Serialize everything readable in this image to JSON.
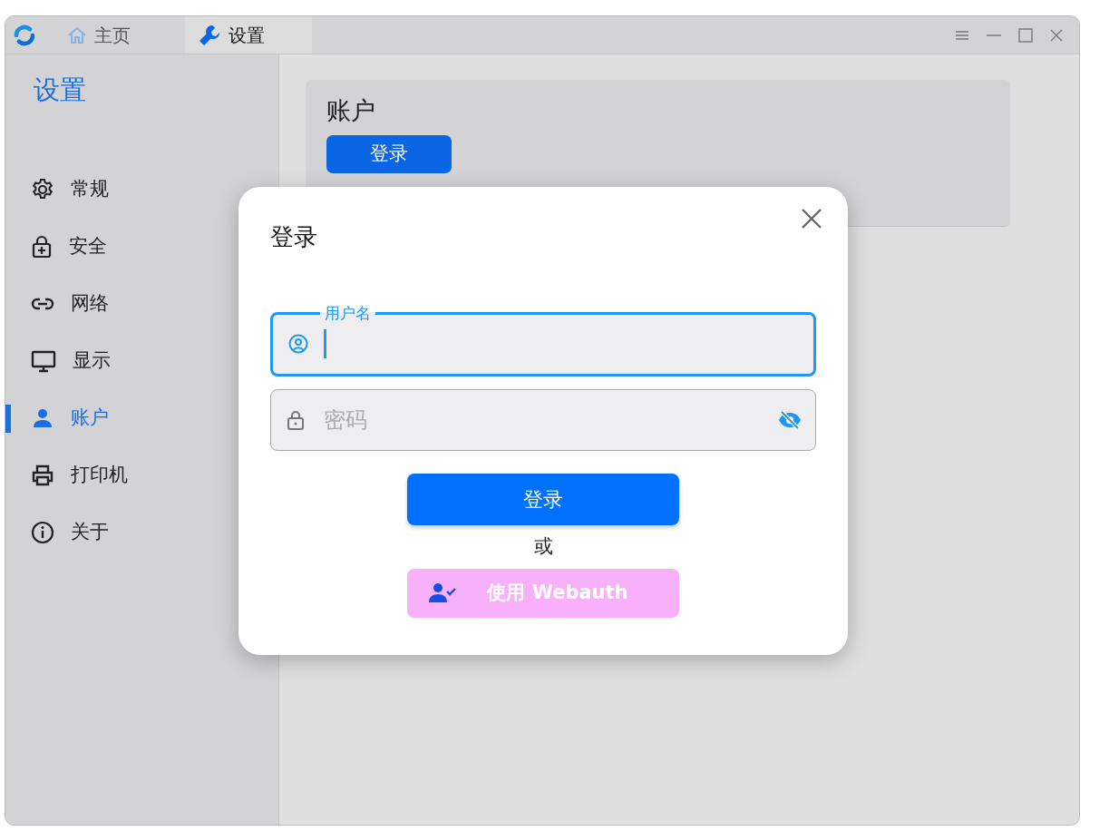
{
  "window": {
    "tabs": [
      {
        "label": "主页",
        "selected": false
      },
      {
        "label": "设置",
        "selected": true
      }
    ]
  },
  "sidebar": {
    "title": "设置",
    "items": [
      {
        "label": "常规",
        "selected": false
      },
      {
        "label": "安全",
        "selected": false
      },
      {
        "label": "网络",
        "selected": false
      },
      {
        "label": "显示",
        "selected": false
      },
      {
        "label": "账户",
        "selected": true
      },
      {
        "label": "打印机",
        "selected": false
      },
      {
        "label": "关于",
        "selected": false
      }
    ]
  },
  "account_card": {
    "title": "账户",
    "button": "登录"
  },
  "dialog": {
    "title": "登录",
    "username": {
      "label": "用户名",
      "focused": true
    },
    "password": {
      "placeholder": "密码",
      "focused": false
    },
    "submit": "登录",
    "separator": "或",
    "webauth": "使用 Webauth"
  }
}
